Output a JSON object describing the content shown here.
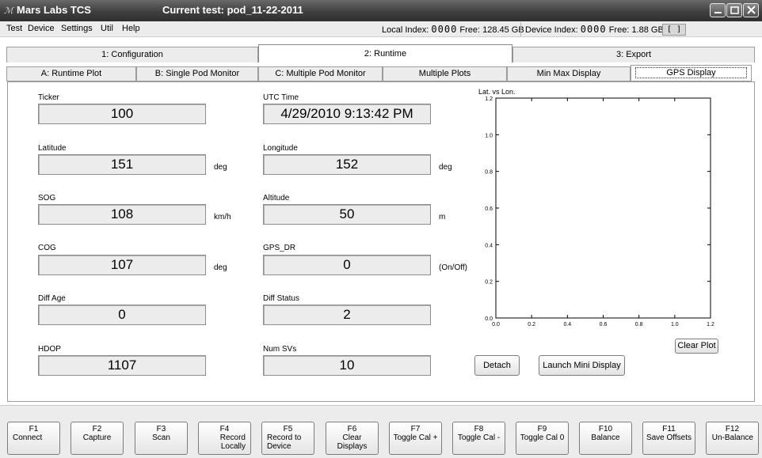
{
  "window": {
    "app_title": "Mars Labs TCS",
    "test_title": "Current test: pod_11-22-2011"
  },
  "menu": {
    "items": [
      "Test",
      "Device",
      "Settings",
      "Util",
      "Help"
    ]
  },
  "status": {
    "local_index_label": "Local Index:",
    "local_index_value": "0000",
    "local_free_label": "Free:",
    "local_free_value": "128.45 GB",
    "device_index_label": "Device Index:",
    "device_index_value": "0000",
    "device_free_label": "Free:",
    "device_free_value": "1.88 GB",
    "bracket": "[  ]"
  },
  "tabs": {
    "main": [
      "1: Configuration",
      "2: Runtime",
      "3: Export"
    ],
    "sub": [
      "A: Runtime Plot",
      "B: Single Pod Monitor",
      "C: Multiple Pod Monitor",
      "Multiple Plots",
      "Min Max Display",
      "GPS Display"
    ]
  },
  "fields": {
    "ticker": {
      "label": "Ticker",
      "value": "100"
    },
    "utc_time": {
      "label": "UTC Time",
      "value": "4/29/2010 9:13:42 PM"
    },
    "latitude": {
      "label": "Latitude",
      "value": "151",
      "unit": "deg"
    },
    "longitude": {
      "label": "Longitude",
      "value": "152",
      "unit": "deg"
    },
    "sog": {
      "label": "SOG",
      "value": "108",
      "unit": "km/h"
    },
    "altitude": {
      "label": "Altitude",
      "value": "50",
      "unit": "m"
    },
    "cog": {
      "label": "COG",
      "value": "107",
      "unit": "deg"
    },
    "gps_dr": {
      "label": "GPS_DR",
      "value": "0",
      "unit": "(On/Off)"
    },
    "diff_age": {
      "label": "Diff Age",
      "value": "0"
    },
    "diff_status": {
      "label": "Diff Status",
      "value": "2"
    },
    "hdop": {
      "label": "HDOP",
      "value": "1107"
    },
    "num_svs": {
      "label": "Num SVs",
      "value": "10"
    }
  },
  "plot": {
    "title": "Lat. vs Lon.",
    "x_ticks": [
      "0.0",
      "0.2",
      "0.4",
      "0.6",
      "0.8",
      "1.0",
      "1.2"
    ],
    "y_ticks": [
      "0.0",
      "0.2",
      "0.4",
      "0.6",
      "0.8",
      "1.0",
      "1.2"
    ]
  },
  "buttons": {
    "clear_plot": "Clear Plot",
    "detach": "Detach",
    "launch_mini": "Launch Mini Display"
  },
  "fkeys": [
    {
      "key": "F1",
      "text": "Connect"
    },
    {
      "key": "F2",
      "text": "Capture"
    },
    {
      "key": "F3",
      "text": "Scan"
    },
    {
      "key": "F4",
      "text": "Record\nLocally"
    },
    {
      "key": "F5",
      "text": "Record to\nDevice"
    },
    {
      "key": "F6",
      "text": "Clear\nDisplays"
    },
    {
      "key": "F7",
      "text": "Toggle Cal +"
    },
    {
      "key": "F8",
      "text": "Toggle Cal -"
    },
    {
      "key": "F9",
      "text": "Toggle Cal 0"
    },
    {
      "key": "F10",
      "text": "Balance"
    },
    {
      "key": "F11",
      "text": "Save Offsets"
    },
    {
      "key": "F12",
      "text": "Un-Balance"
    }
  ]
}
